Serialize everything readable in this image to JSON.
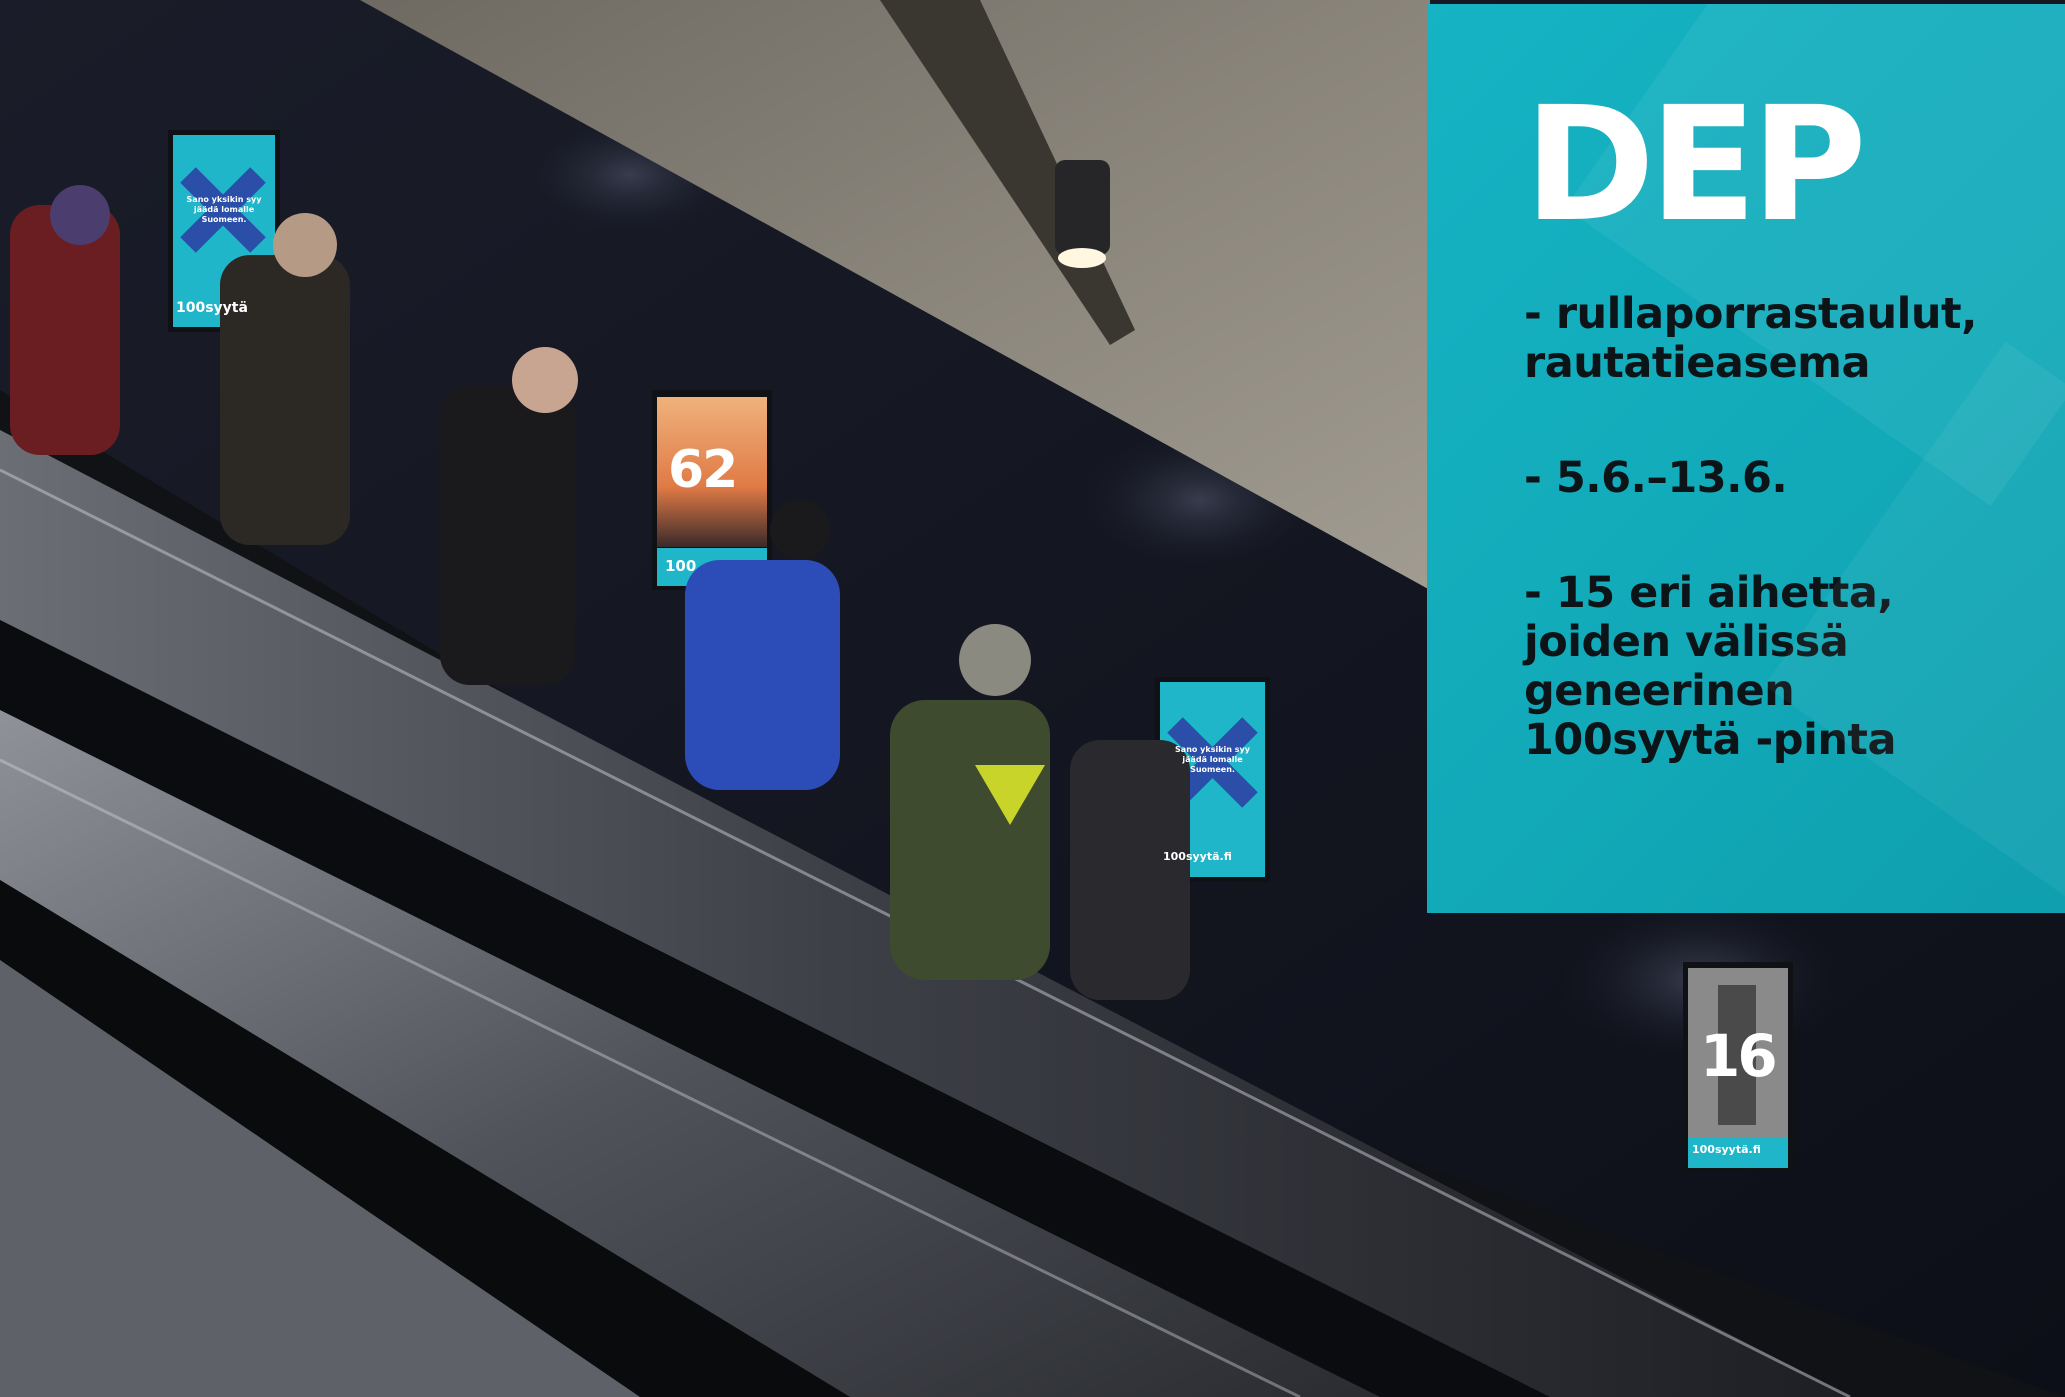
{
  "panel": {
    "title": "DEP",
    "bullets": [
      "- rullaporrastaulut,\nrautatieasema",
      "- 5.6.–13.6.",
      "- 15 eri aihetta,\njoiden välissä\ngeneerinen\n100syytä -pinta"
    ],
    "background_color": "#14adbd",
    "title_color": "#ffffff",
    "text_color": "#0c1418"
  },
  "posters": [
    {
      "id": "poster-1",
      "number": "",
      "message": "Sano yksikin syy jäädä lomalle Suomeen.",
      "brand": "100syytä"
    },
    {
      "id": "poster-2",
      "number": "62",
      "message": "",
      "brand": "100"
    },
    {
      "id": "poster-3",
      "number": "",
      "message": "Sano yksikin syy jäädä lomalle Suomeen.",
      "brand": "100syytä.fi"
    },
    {
      "id": "poster-4",
      "number": "16",
      "message": "",
      "brand": "100syytä.fi"
    }
  ],
  "colors": {
    "accent": "#14adbd",
    "poster_blue": "#1fb6c9",
    "x_mark": "#2b4fa8"
  }
}
